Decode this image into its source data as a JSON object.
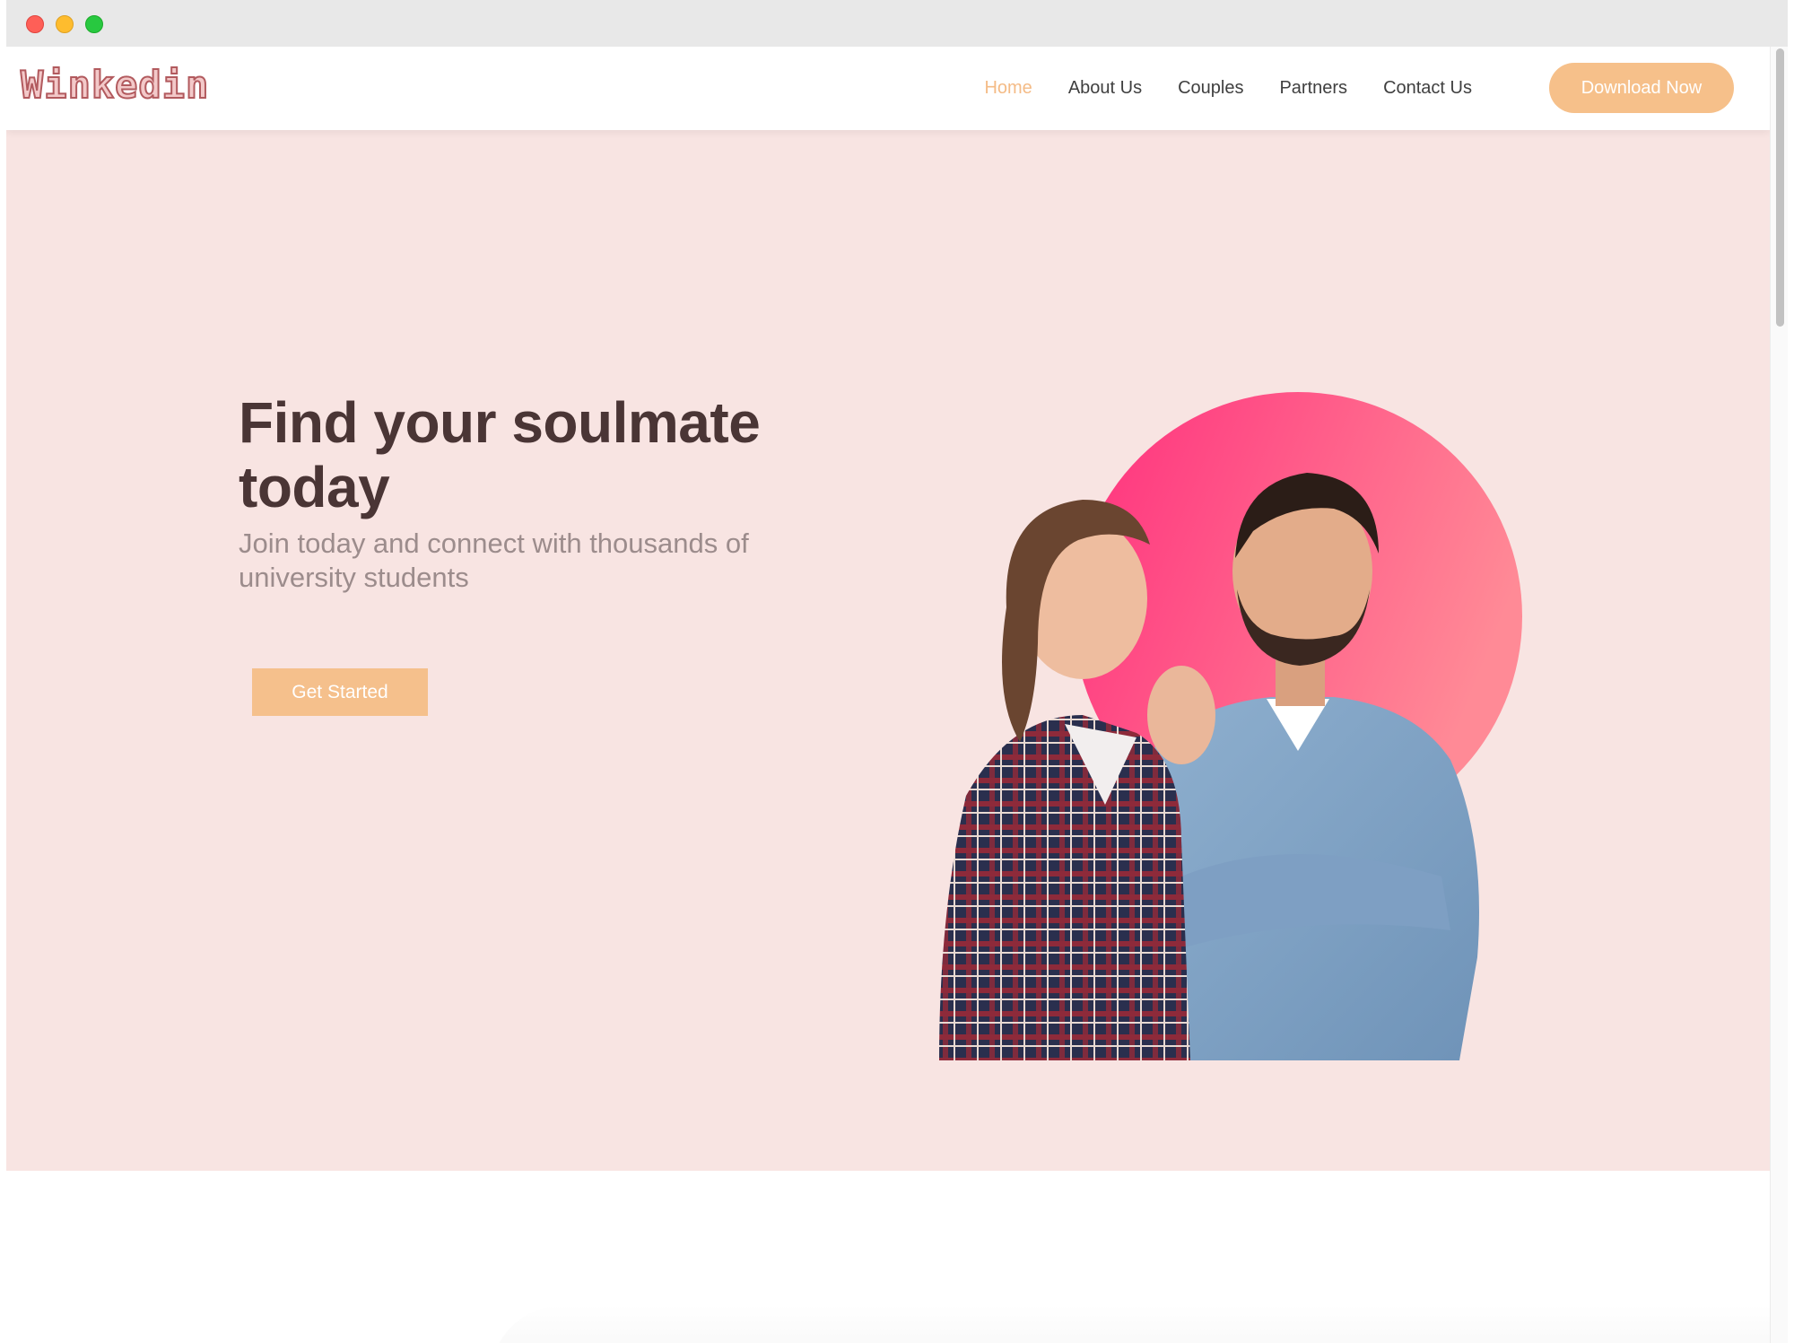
{
  "window": {
    "traffic_lights": [
      "close",
      "minimize",
      "zoom"
    ]
  },
  "nav": {
    "logo": "Winkedin",
    "links": [
      {
        "label": "Home",
        "active": true
      },
      {
        "label": "About Us",
        "active": false
      },
      {
        "label": "Couples",
        "active": false
      },
      {
        "label": "Partners",
        "active": false
      },
      {
        "label": "Contact Us",
        "active": false
      }
    ],
    "cta": "Download Now"
  },
  "hero": {
    "title": "Find your soulmate today",
    "subtitle": "Join today and connect with thousands of university students",
    "button": "Get Started",
    "image_icon": "couple-photo"
  },
  "colors": {
    "accent": "#f5c08c",
    "active_link": "#f4bb86",
    "hero_bg": "#f8e4e2",
    "title": "#4a3535",
    "circle_start": "#ff2f7d",
    "circle_end": "#ff7f94"
  }
}
